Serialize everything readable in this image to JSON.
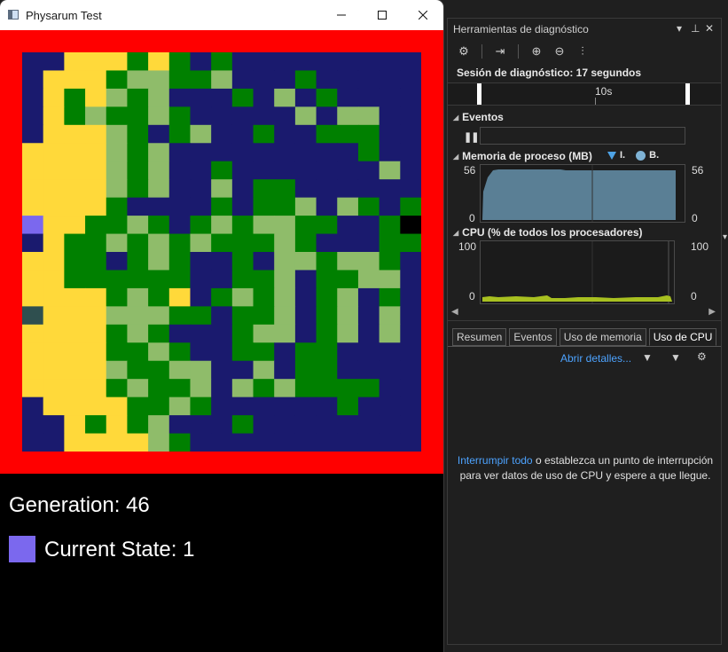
{
  "app": {
    "title": "Physarum Test",
    "minimize_icon": "minimize-icon",
    "maximize_icon": "maximize-icon",
    "close_icon": "close-icon",
    "generation_text": "Generation: 46",
    "state_text": "Current State: 1",
    "state_color": "#7b68ee",
    "border_color": "#ff0000",
    "palette": {
      "D": "#1a1a6e",
      "Y": "#ffd93a",
      "G": "#008000",
      "L": "#8fbc6a",
      "P": "#7b68ee",
      "T": "#2f4f4f",
      "K": "#000000"
    },
    "grid": [
      "DDYYYGYGDGDDDDDDDDD",
      "DYYYGLLGGLDDDGDDDDD",
      "DYGYLGLDDDGDLDGDDDD",
      "DYGLGGLGDDDDDLDLLDD",
      "DYYYLGDGLDDGDDGGGDD",
      "YYYYLGLDDDDDDDDDGDD",
      "YYYYLGLDDGDDDDDDDLD",
      "YYYYLGLDDLDGGDDDDDD",
      "YYYYGDDDDGDGGLDLGDG",
      "PYYGGLGDGLGLLGGDDGK",
      "DYGGLGLGLGGGLGDDDGG",
      "YYGGDGLGDDGDLLGLLGD",
      "YYGGGGGGDDGGLDGGLLD",
      "YYYYGLGYDGLGLDGLDGD",
      "TYYYLLLGGDGGLDGLDLD",
      "YYYYGLGDDDGLLDGLDLD",
      "YYYYGGLGDDGGDGGDDDD",
      "YYYYLGGLLDDLDGGDDDD",
      "YYYYGLGGLDLGLGGGGDD",
      "DYYYYGGLGDDDDDDGDDD",
      "DDYGYGLDDDGDDDDDDDD",
      "DDYYYYLGDDDDDDDDDDD"
    ]
  },
  "diag": {
    "title": "Herramientas de diagnóstico",
    "controls": [
      "▾",
      "⊥",
      "✕"
    ],
    "session_label": "Sesión de diagnóstico: 17 segundos",
    "timeline_label": "10s",
    "events_label": "Eventos",
    "pause_glyph": "❚❚",
    "memory_label": "Memoria de proceso (MB)",
    "memory_legend_1": "I.",
    "memory_legend_2": "B.",
    "memory_ymax": "56",
    "memory_ymin": "0",
    "memory_ymax_right": "56",
    "memory_ymin_right": "0",
    "cpu_label": "CPU (% de todos los procesadores)",
    "cpu_ymax": "100",
    "cpu_ymin": "0",
    "cpu_ymax_right": "100",
    "cpu_ymin_right": "0",
    "tabs": [
      "Resumen",
      "Eventos",
      "Uso de memoria",
      "Uso de CPU"
    ],
    "details_link": "Abrir detalles...",
    "msg_link": "Interrumpir todo",
    "msg_rest1": " o establezca un punto de interrupción",
    "msg_rest2": "para ver datos de uso de CPU y espere a que llegue.",
    "scroll_left": "◀",
    "scroll_right": "▶",
    "edge_glyph": "▾",
    "memory_fill": "#5a7f95",
    "cpu_color": "#a8c020"
  }
}
